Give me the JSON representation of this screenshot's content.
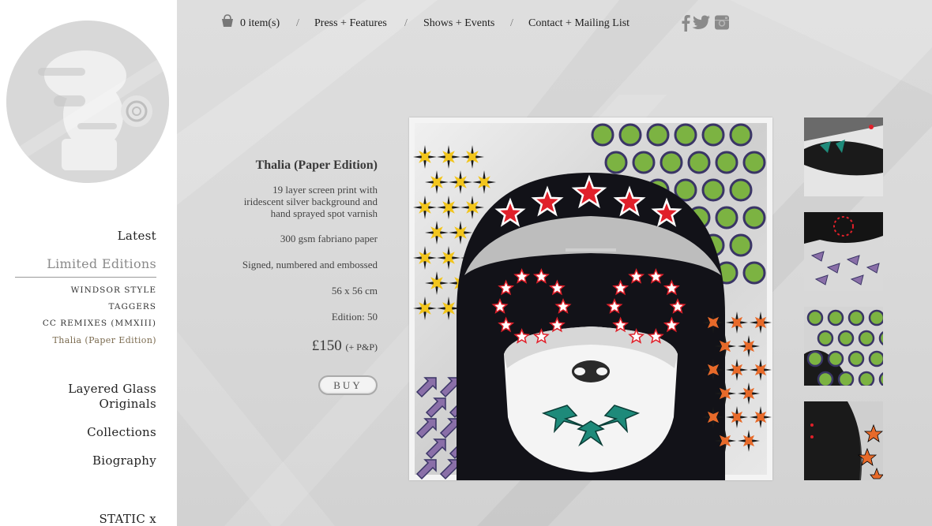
{
  "sidebar": {
    "nav": {
      "latest": "Latest",
      "limited_editions": "Limited Editions",
      "layered_glass_1": "Layered Glass",
      "layered_glass_2": "Originals",
      "collections": "Collections",
      "biography": "Biography",
      "static": "STATIC x"
    },
    "sub_items": [
      "WINDSOR STYLE",
      "TAGGERS",
      "CC REMIXES (MMXIII)",
      "Thalia (Paper Edition)"
    ]
  },
  "topnav": {
    "cart": "0 item(s)",
    "separator": "/",
    "press": "Press + Features",
    "shows": "Shows + Events",
    "contact": "Contact + Mailing List"
  },
  "social": [
    "facebook-icon",
    "twitter-icon",
    "instagram-icon"
  ],
  "product": {
    "title": "Thalia (Paper Edition)",
    "desc_lines": [
      "19 layer screen print with",
      "iridescent silver background and",
      "hand sprayed spot varnish"
    ],
    "paper": "300 gsm fabriano paper",
    "signed": "Signed, numbered and embossed",
    "size": "56 x 56 cm",
    "edition": "Edition: 50",
    "price": "£150",
    "price_note": "(+ P&P)",
    "buy_label": "BUY"
  },
  "colors": {
    "accent_red": "#e0202a",
    "accent_green": "#7cb342",
    "navy": "#3a3566",
    "teal": "#1e8a7a"
  }
}
